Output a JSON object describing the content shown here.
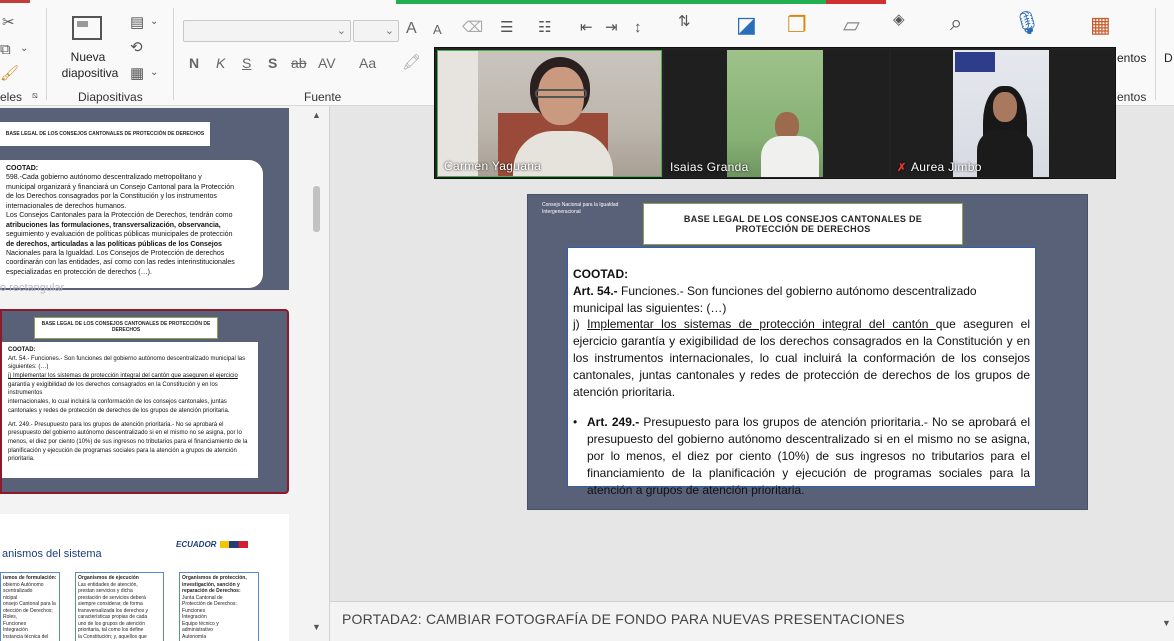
{
  "ribbon": {
    "clipboard_label": "eles",
    "new_slide_label_1": "Nueva",
    "new_slide_label_2": "diapositiva",
    "slides_group_label": "Diapositivas",
    "font_group_label": "Fuente",
    "right_group_1": "entos",
    "right_group_2": "entos",
    "right_partial": "D",
    "font_format": {
      "bold": "N",
      "italic": "K",
      "underline": "S",
      "shadow": "S",
      "strike": "ab",
      "spacing": "AV",
      "case": "Aa",
      "grow": "A",
      "shrink": "A"
    },
    "font_name_value": "",
    "font_size_value": ""
  },
  "left_pane": {
    "thumb1": {
      "title": "BASE LEGAL DE LOS CONSEJOS CANTONALES DE PROTECCIÓN DE DERECHOS",
      "text_lines": [
        "COOTAD:",
        "598.-Cada gobierno autónomo descentralizado metropolitano y",
        "municipal organizará y financiará un Consejo Cantonal para la Protección",
        "de los Derechos consagrados por la Constitución y los instrumentos",
        "internacionales de derechos humanos.",
        "Los Consejos Cantonales para la Protección de Derechos, tendrán como",
        "atribuciones las formulaciones, transversalización, observancia,",
        "seguimiento y evaluación de políticas públicas municipales de protección",
        "de derechos, articuladas a las políticas públicas de los Consejos",
        "Nacionales para la Igualdad. Los Consejos de Protección de derechos",
        "coordinarán con las entidades, así como con las redes interinstitucionales",
        "especializadas en protección de derechos (…)."
      ],
      "ghost_text": "o rectangular"
    },
    "thumb2": {
      "title": "BASE LEGAL DE LOS CONSEJOS CANTONALES DE PROTECCIÓN DE DERECHOS",
      "text_lines": [
        "COOTAD:",
        "Art. 54.- Funciones.- Son funciones del gobierno autónomo descentralizado municipal las",
        "siguientes: (…)",
        "j) Implementar los sistemas de protección integral del cantón que aseguren el ejercicio",
        "garantía y exigibilidad de los derechos consagrados en la Constitución y en los instrumentos",
        "internacionales, lo cual incluirá la conformación de los consejos cantonales, juntas",
        "cantonales y redes de protección de derechos de los grupos de atención prioritaria.",
        "",
        "Art. 249.- Presupuesto para los grupos de atención prioritaria.- No se aprobará el",
        "presupuesto del gobierno autónomo descentralizado si en el mismo no se asigna, por lo",
        "menos, el diez por ciento (10%) de sus ingresos no tributarios para el financiamiento de la",
        "planificación y ejecución de programas sociales para la atención a grupos de atención",
        "prioritaria."
      ]
    },
    "thumb3": {
      "heading": "anismos del sistema",
      "brand": "ECUADOR",
      "col1_title": "ismos de formulación:",
      "col1_lines": [
        "obierno Autónomo",
        "scentralizado",
        "nicipal",
        "onsejo Cantonal para la",
        "otección de Derechos;",
        "Roles,",
        "Funciones",
        "Integración",
        "Instancia técnica del"
      ],
      "col2_title": "Organismos de ejecución",
      "col2_lines": [
        "Las entidades de atención,",
        "prestan servicios y dicha",
        "prestación de servicios deberá",
        "siempre considerar, de forma",
        "transversalizada los derechos y",
        "características propias de cada",
        "uno de los grupos de atención",
        "prioritaria, tal como los define",
        "la Constitución; y, aquellos que"
      ],
      "col3_title": "Organismos de protección, investigación, sanción y reparación de Derechos:",
      "col3_lines": [
        "Junta Cantonal de",
        "Protección de Derechos:",
        "Funciones",
        "Integración",
        "Equipo técnico y",
        "administrativo",
        "Autonomía"
      ]
    }
  },
  "slide": {
    "org_name": "Consejo Nacional para la Igualdad Intergeneracional",
    "title": "BASE LEGAL DE LOS CONSEJOS CANTONALES DE PROTECCIÓN DE DERECHOS",
    "cootad": "COOTAD:",
    "art54_label": "Art. 54.-",
    "art54_text": " Funciones.- Son funciones del gobierno autónomo descentralizado municipal las siguientes: (…)",
    "j_prefix": " j) ",
    "j_underlined": "Implementar los sistemas de protección integral del cantón ",
    "j_text": "que aseguren el ejercicio garantía y exigibilidad de los derechos consagrados en la Constitución y en los instrumentos internacionales, lo cual incluirá la conformación de los consejos cantonales, juntas cantonales y redes de protección de derechos de los grupos de atención prioritaria.",
    "art249_label": "Art. 249.-",
    "art249_text": " Presupuesto para los grupos de atención prioritaria.- No se aprobará el presupuesto del gobierno autónomo descentralizado si en el mismo no se asigna, por lo menos, el diez por ciento (10%) de sus ingresos no tributarios para el financiamiento de la planificación y ejecución de programas sociales para la atención a grupos de atención prioritaria."
  },
  "notes": {
    "text": "PORTADA2: CAMBIAR FOTOGRAFÍA DE FONDO PARA NUEVAS PRESENTACIONES"
  },
  "video": {
    "participants": [
      {
        "name": "Carmen Yaguana",
        "muted": false
      },
      {
        "name": "Isaias Granda",
        "muted": false
      },
      {
        "name": "Aurea Jimbo",
        "muted": true
      }
    ]
  }
}
